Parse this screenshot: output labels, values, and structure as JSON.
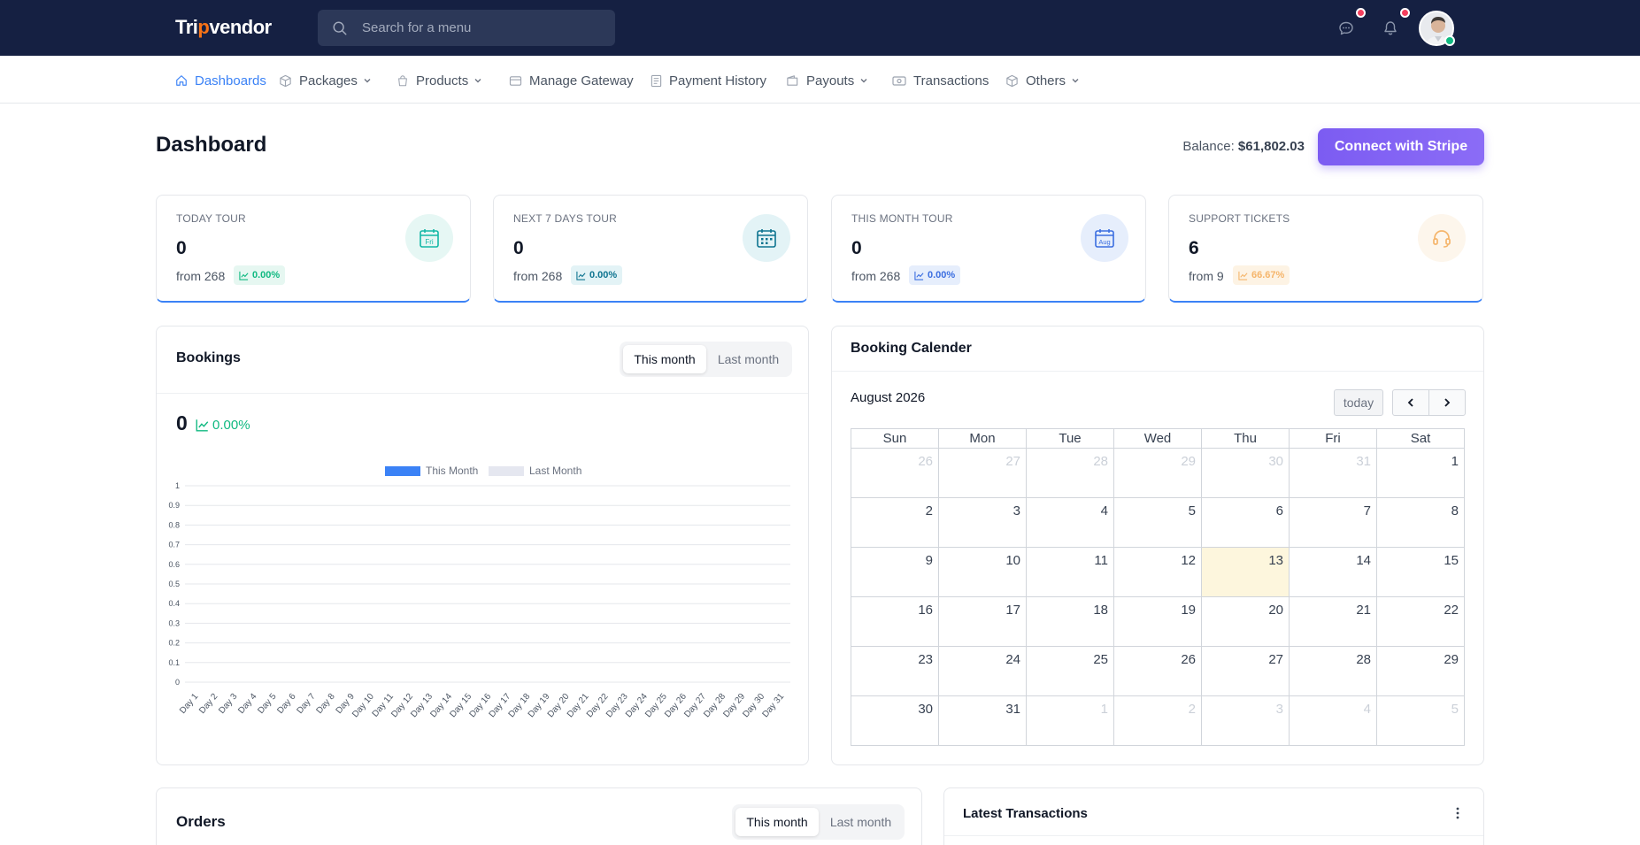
{
  "brand": {
    "logo_pre": "Tri",
    "logo_mark": "p",
    "logo_post": "vendor"
  },
  "search": {
    "placeholder": "Search for a menu"
  },
  "topbar_icons": [
    "chat-icon",
    "bell-icon"
  ],
  "nav": {
    "items": [
      {
        "label": "Dashboards",
        "icon": "home-icon",
        "active": true,
        "dropdown": false
      },
      {
        "label": "Packages",
        "icon": "box-icon",
        "active": false,
        "dropdown": true
      },
      {
        "label": "Products",
        "icon": "bag-icon",
        "active": false,
        "dropdown": true
      },
      {
        "label": "Manage Gateway",
        "icon": "card-icon",
        "active": false,
        "dropdown": false
      },
      {
        "label": "Payment History",
        "icon": "receipt-icon",
        "active": false,
        "dropdown": false
      },
      {
        "label": "Payouts",
        "icon": "wallet-icon",
        "active": false,
        "dropdown": true
      },
      {
        "label": "Transactions",
        "icon": "cash-icon",
        "active": false,
        "dropdown": false
      },
      {
        "label": "Others",
        "icon": "cube-icon",
        "active": false,
        "dropdown": true
      }
    ]
  },
  "page": {
    "title": "Dashboard",
    "balance_label": "Balance:",
    "balance_value": "$61,802.03",
    "stripe_button": "Connect with Stripe"
  },
  "stats": [
    {
      "label": "TODAY TOUR",
      "value": "0",
      "from": "from 268",
      "pct": "0.00%",
      "icon_text": "Fri",
      "accent": "#14b8a6",
      "bg": "#e6f7f4",
      "pct_color": "#10b981",
      "pct_bg": "#e6f7f1"
    },
    {
      "label": "NEXT 7 DAYS TOUR",
      "value": "0",
      "from": "from 268",
      "pct": "0.00%",
      "icon_text": "",
      "accent": "#0e7490",
      "bg": "#e3f3f6",
      "pct_color": "#0e7490",
      "pct_bg": "#e3f3f6"
    },
    {
      "label": "THIS MONTH TOUR",
      "value": "0",
      "from": "from 268",
      "pct": "0.00%",
      "icon_text": "Aug",
      "accent": "#3b6ee0",
      "bg": "#e6eefc",
      "pct_color": "#3b6ee0",
      "pct_bg": "#e6eefc"
    },
    {
      "label": "SUPPORT TICKETS",
      "value": "6",
      "from": "from 9",
      "pct": "66.67%",
      "icon_text": "",
      "accent": "#f59e0b",
      "bg": "#fdf6ec",
      "pct_color": "#f5b56b",
      "pct_bg": "#fdf3e4"
    }
  ],
  "bookings": {
    "title": "Bookings",
    "tabs": [
      "This month",
      "Last month"
    ],
    "active_tab": 0,
    "total": "0",
    "pct": "0.00%"
  },
  "chart_data": {
    "type": "bar",
    "title": "",
    "legend": [
      "This Month",
      "Last Month"
    ],
    "legend_position": "top",
    "categories": [
      "Day 1",
      "Day 2",
      "Day 3",
      "Day 4",
      "Day 5",
      "Day 6",
      "Day 7",
      "Day 8",
      "Day 9",
      "Day 10",
      "Day 11",
      "Day 12",
      "Day 13",
      "Day 14",
      "Day 15",
      "Day 16",
      "Day 17",
      "Day 18",
      "Day 19",
      "Day 20",
      "Day 21",
      "Day 22",
      "Day 23",
      "Day 24",
      "Day 25",
      "Day 26",
      "Day 27",
      "Day 28",
      "Day 29",
      "Day 30",
      "Day 31"
    ],
    "series": [
      {
        "name": "This Month",
        "color": "#3b82f6",
        "values": [
          0,
          0,
          0,
          0,
          0,
          0,
          0,
          0,
          0,
          0,
          0,
          0,
          0,
          0,
          0,
          0,
          0,
          0,
          0,
          0,
          0,
          0,
          0,
          0,
          0,
          0,
          0,
          0,
          0,
          0,
          0
        ]
      },
      {
        "name": "Last Month",
        "color": "#e5e7f0",
        "values": [
          0,
          0,
          0,
          0,
          0,
          0,
          0,
          0,
          0,
          0,
          0,
          0,
          0,
          0,
          0,
          0,
          0,
          0,
          0,
          0,
          0,
          0,
          0,
          0,
          0,
          0,
          0,
          0,
          0,
          0,
          0
        ]
      }
    ],
    "y_ticks": [
      "0",
      "0.1",
      "0.2",
      "0.3",
      "0.4",
      "0.5",
      "0.6",
      "0.7",
      "0.8",
      "0.9",
      "1"
    ],
    "ylim": [
      0,
      1
    ],
    "grid": true
  },
  "calendar": {
    "title": "Booking Calender",
    "month_label": "August 2026",
    "today_label": "today",
    "weekdays": [
      "Sun",
      "Mon",
      "Tue",
      "Wed",
      "Thu",
      "Fri",
      "Sat"
    ],
    "weeks": [
      [
        {
          "d": "26",
          "m": true
        },
        {
          "d": "27",
          "m": true
        },
        {
          "d": "28",
          "m": true
        },
        {
          "d": "29",
          "m": true
        },
        {
          "d": "30",
          "m": true
        },
        {
          "d": "31",
          "m": true
        },
        {
          "d": "1"
        }
      ],
      [
        {
          "d": "2"
        },
        {
          "d": "3"
        },
        {
          "d": "4"
        },
        {
          "d": "5"
        },
        {
          "d": "6"
        },
        {
          "d": "7"
        },
        {
          "d": "8"
        }
      ],
      [
        {
          "d": "9"
        },
        {
          "d": "10"
        },
        {
          "d": "11"
        },
        {
          "d": "12"
        },
        {
          "d": "13",
          "today": true
        },
        {
          "d": "14"
        },
        {
          "d": "15"
        }
      ],
      [
        {
          "d": "16"
        },
        {
          "d": "17"
        },
        {
          "d": "18"
        },
        {
          "d": "19"
        },
        {
          "d": "20"
        },
        {
          "d": "21"
        },
        {
          "d": "22"
        }
      ],
      [
        {
          "d": "23"
        },
        {
          "d": "24"
        },
        {
          "d": "25"
        },
        {
          "d": "26"
        },
        {
          "d": "27"
        },
        {
          "d": "28"
        },
        {
          "d": "29"
        }
      ],
      [
        {
          "d": "30"
        },
        {
          "d": "31"
        },
        {
          "d": "1",
          "m": true
        },
        {
          "d": "2",
          "m": true
        },
        {
          "d": "3",
          "m": true
        },
        {
          "d": "4",
          "m": true
        },
        {
          "d": "5",
          "m": true
        }
      ]
    ]
  },
  "orders": {
    "title": "Orders",
    "tabs": [
      "This month",
      "Last month"
    ],
    "active_tab": 0
  },
  "transactions": {
    "title": "Latest Transactions"
  }
}
